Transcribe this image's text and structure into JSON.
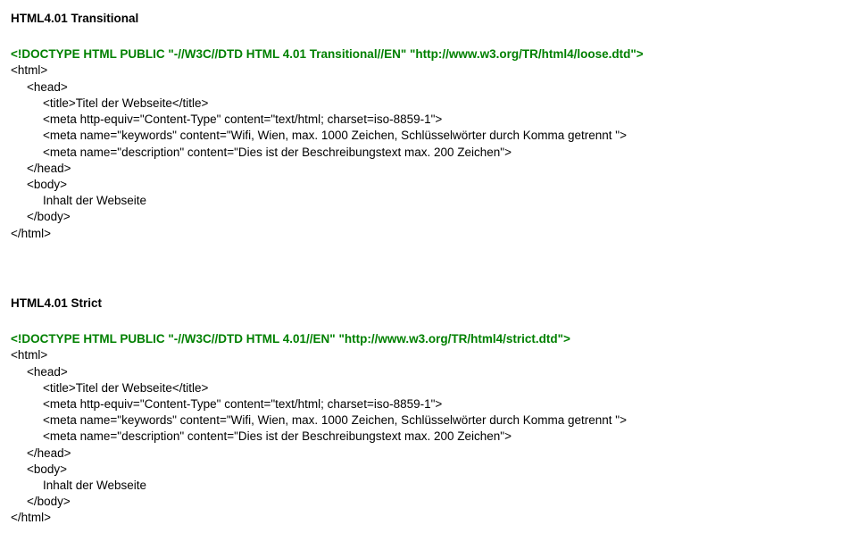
{
  "section1": {
    "heading": "HTML4.01 Transitional",
    "doctype": "<!DOCTYPE HTML PUBLIC \"-//W3C//DTD HTML 4.01 Transitional//EN\" \"http://www.w3.org/TR/html4/loose.dtd\">",
    "l_html": "<html>",
    "l_head": "<head>",
    "l_title": "<title>Titel der Webseite</title>",
    "l_meta_ct": "<meta http-equiv=\"Content-Type\" content=\"text/html; charset=iso-8859-1\">",
    "l_meta_kw": "<meta name=\"keywords\" content=\"Wifi, Wien, max. 1000 Zeichen, Schlüsselwörter durch Komma getrennt \">",
    "l_meta_desc": "<meta name=\"description\" content=\"Dies ist der Beschreibungstext max. 200 Zeichen\">",
    "l_head_close": "</head>",
    "l_body": "<body>",
    "l_content": "Inhalt der Webseite",
    "l_body_close": "</body>",
    "l_html_close": "</html>"
  },
  "section2": {
    "heading": "HTML4.01 Strict",
    "doctype": "<!DOCTYPE HTML PUBLIC \"-//W3C//DTD HTML 4.01//EN\" \"http://www.w3.org/TR/html4/strict.dtd\">",
    "l_html": "<html>",
    "l_head": "<head>",
    "l_title": "<title>Titel der Webseite</title>",
    "l_meta_ct": "<meta http-equiv=\"Content-Type\" content=\"text/html; charset=iso-8859-1\">",
    "l_meta_kw": "<meta name=\"keywords\" content=\"Wifi, Wien, max. 1000 Zeichen, Schlüsselwörter durch Komma getrennt \">",
    "l_meta_desc": "<meta name=\"description\" content=\"Dies ist der Beschreibungstext max. 200 Zeichen\">",
    "l_head_close": "</head>",
    "l_body": "<body>",
    "l_content": "Inhalt der Webseite",
    "l_body_close": "</body>",
    "l_html_close": "</html>"
  }
}
